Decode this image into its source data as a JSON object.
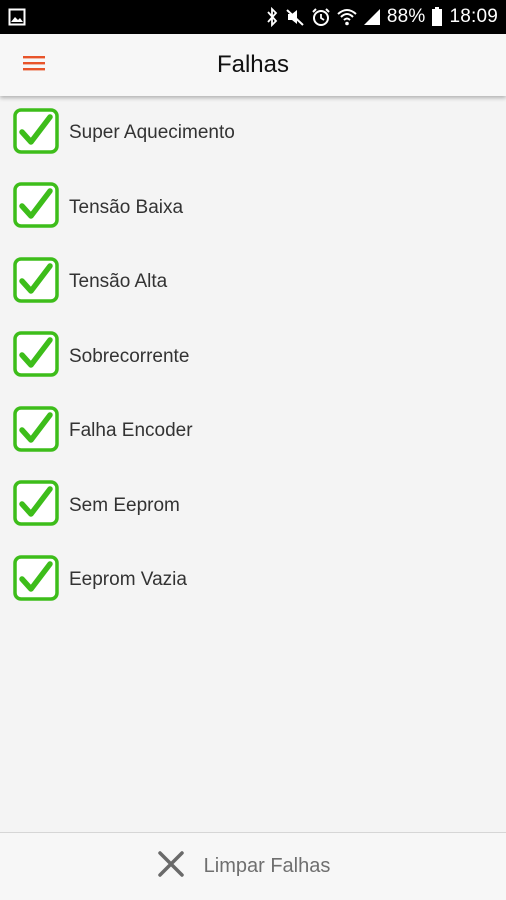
{
  "status_bar": {
    "battery": "88%",
    "time": "18:09",
    "icons": [
      "image-icon",
      "bluetooth-icon",
      "mute-icon",
      "alarm-icon",
      "wifi-icon",
      "signal-icon",
      "battery-icon"
    ]
  },
  "app_bar": {
    "title": "Falhas",
    "menu_icon": "hamburger-menu-icon",
    "accent_color": "#e8542a"
  },
  "faults": {
    "check_color": "#3dbd1a",
    "items": [
      {
        "label": "Super Aquecimento",
        "checked": true
      },
      {
        "label": "Tensão Baixa",
        "checked": true
      },
      {
        "label": "Tensão Alta",
        "checked": true
      },
      {
        "label": "Sobrecorrente",
        "checked": true
      },
      {
        "label": "Falha Encoder",
        "checked": true
      },
      {
        "label": "Sem Eeprom",
        "checked": true
      },
      {
        "label": "Eeprom Vazia",
        "checked": true
      }
    ]
  },
  "bottom_bar": {
    "clear_label": "Limpar Falhas",
    "clear_icon": "close-x-icon"
  }
}
